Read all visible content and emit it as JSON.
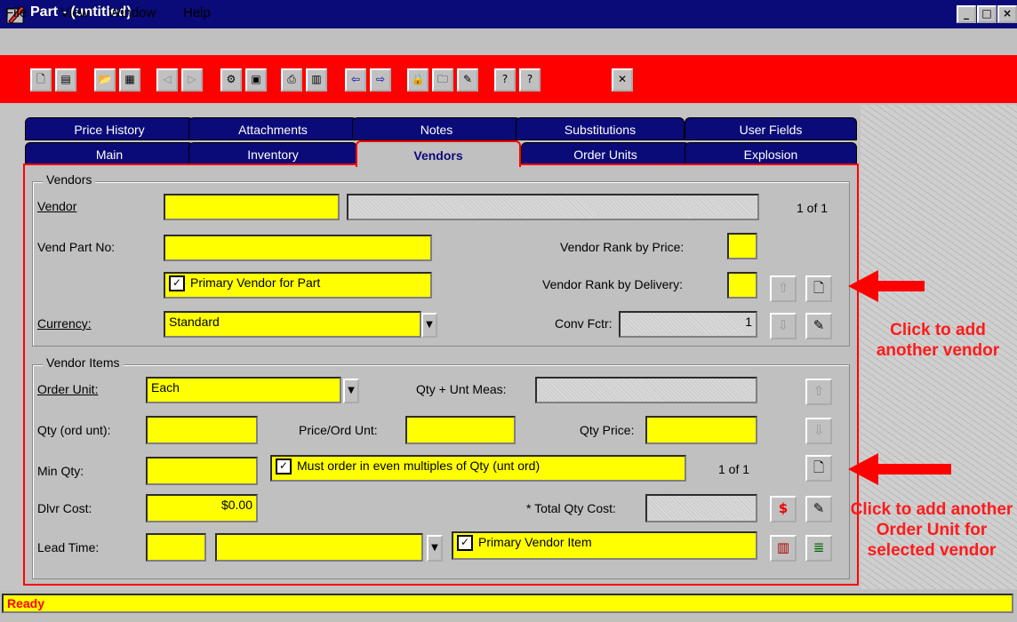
{
  "window": {
    "title": "Part - (untitled)"
  },
  "menu": [
    "File",
    "View",
    "Window",
    "Help"
  ],
  "toolbar_icons": [
    "new-icon",
    "copy-icon",
    "open-icon",
    "save-icon",
    "first-icon",
    "last-icon",
    "find-icon",
    "disk-icon",
    "print-icon",
    "preview-icon",
    "prev-icon",
    "next-icon",
    "lock-icon",
    "folder-icon",
    "edit-icon",
    "help-icon",
    "help-context-icon",
    "close-icon"
  ],
  "tabs_back": [
    "Price History",
    "Attachments",
    "Notes",
    "Substitutions",
    "User Fields"
  ],
  "tabs_front": [
    "Main",
    "Inventory",
    "Vendors",
    "Order Units",
    "Explosion"
  ],
  "vendors": {
    "group_label": "Vendors",
    "vendor_label": "Vendor",
    "vendor_value": "",
    "vendor_count": "1 of 1",
    "vend_part_label": "Vend Part No:",
    "rank_price_label": "Vendor Rank by Price:",
    "rank_delivery_label": "Vendor Rank by Delivery:",
    "primary_vendor_label": "Primary Vendor for Part",
    "currency_label": "Currency:",
    "currency_value": "Standard",
    "conv_label": "Conv Fctr:",
    "conv_value": "1"
  },
  "vendor_items": {
    "group_label": "Vendor Items",
    "order_unit_label": "Order Unit:",
    "order_unit_value": "Each",
    "qty_unt_label": "Qty + Unt Meas:",
    "qty_ord_label": "Qty (ord unt):",
    "price_ord_label": "Price/Ord Unt:",
    "qty_price_label": "Qty Price:",
    "min_qty_label": "Min Qty:",
    "multiples_label": "Must order in even multiples of Qty (unt ord)",
    "item_count": "1 of 1",
    "dlvr_label": "Dlvr Cost:",
    "dlvr_value": "$0.00",
    "total_label": "* Total Qty Cost:",
    "lead_label": "Lead Time:",
    "primary_item_label": "Primary Vendor Item"
  },
  "annotations": {
    "add_vendor": "Click to add another vendor",
    "add_order_unit": "Click to add another Order Unit for selected vendor"
  },
  "status": "Ready",
  "colors": {
    "title_bg": "#0a0a78",
    "toolbar_bg": "#ff0000",
    "field": "#ffff00",
    "annotation": "#ff1a1a"
  }
}
